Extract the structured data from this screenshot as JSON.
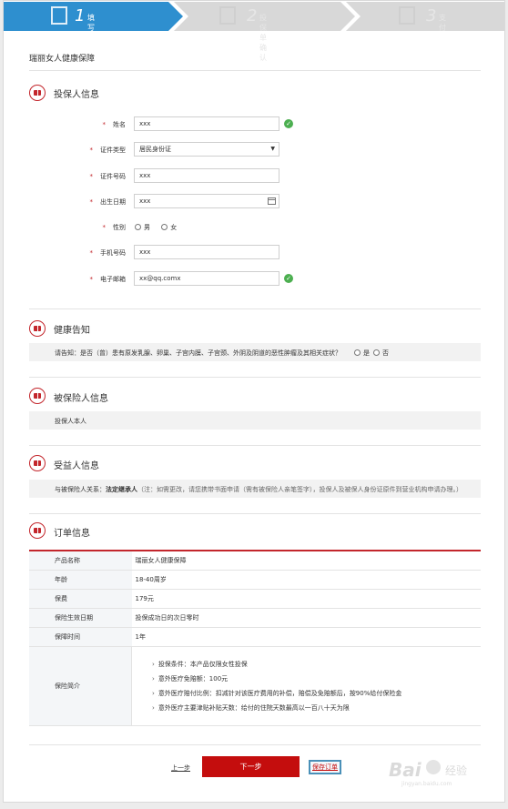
{
  "steps": [
    {
      "num": "1",
      "label": "填写投保信息"
    },
    {
      "num": "2",
      "label": "投保单确认"
    },
    {
      "num": "3",
      "label": "支付"
    }
  ],
  "product": {
    "title": "瑞丽女人健康保障"
  },
  "policyholder": {
    "section_title": "投保人信息",
    "required_mark": "*",
    "fields": {
      "name": {
        "label": "姓名",
        "value": "xxx"
      },
      "id_type": {
        "label": "证件类型",
        "value": "居民身份证"
      },
      "id_number": {
        "label": "证件号码",
        "value": "xxx"
      },
      "birth_date": {
        "label": "出生日期",
        "value": "xxx"
      },
      "gender": {
        "label": "性别",
        "options": [
          "男",
          "女"
        ]
      },
      "phone": {
        "label": "手机号码",
        "value": "xxx"
      },
      "email": {
        "label": "电子邮箱",
        "value": "xx@qq.comx"
      }
    }
  },
  "health": {
    "section_title": "健康告知",
    "question": "请告知：是否（曾）患有原发乳腺、卵巢、子宫内膜、子宫颈、外阴及阴道的恶性肿瘤及其相关症状？",
    "options": [
      "是",
      "否"
    ]
  },
  "insured": {
    "section_title": "被保险人信息",
    "value": "投保人本人"
  },
  "beneficiary": {
    "section_title": "受益人信息",
    "label": "与被保险人关系：",
    "value": "法定继承人",
    "note": "（注：如需更改，请您携带书面申请（需有被保险人亲笔签字），投保人及被保人身份证原件到营业机构申请办理。）"
  },
  "order": {
    "section_title": "订单信息",
    "rows": [
      {
        "key": "产品名称",
        "value": "瑞丽女人健康保障"
      },
      {
        "key": "年龄",
        "value": "18-40周岁"
      },
      {
        "key": "保费",
        "value": "179元"
      },
      {
        "key": "保险生效日期",
        "value": "投保成功日的次日零时"
      },
      {
        "key": "保障时间",
        "value": "1年"
      }
    ],
    "summary_key": "保险简介",
    "summary_items": [
      "投保条件：本产品仅限女性投保",
      "意外医疗免赔额：100元",
      "意外医疗赔付比例：扣减针对该医疗费用的补偿，赔偿及免赔额后，按90%给付保险金",
      "意外医疗主要津贴补贴天数：给付的住院天数最高以一百八十天为限"
    ]
  },
  "footer": {
    "prev": "上一步",
    "next": "下一步",
    "save": "保存订单"
  },
  "watermark": {
    "text": "Bai",
    "suffix": "经验",
    "domain": "jingyan.baidu.com"
  },
  "colors": {
    "accent": "#c3262c",
    "step_active": "#2e8fcf",
    "next_button": "#c40d0d",
    "success": "#4caf50"
  }
}
